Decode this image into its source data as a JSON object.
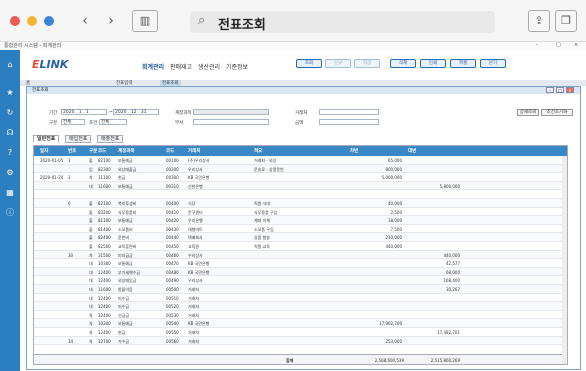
{
  "mac": {
    "title": "전표조회"
  },
  "win": {
    "doc_title": "통합관리 시스템 - 회계관리",
    "minimize": "-",
    "restore": "□",
    "close": "×"
  },
  "header": {
    "logo_e": "E",
    "logo_link": "LINK",
    "menu": [
      "회계관리",
      "판매재고",
      "생산관리",
      "기준정보"
    ],
    "buttons": [
      "조회",
      "신규",
      "저장",
      "삭제",
      "인쇄",
      "엑셀",
      "닫기"
    ]
  },
  "tabs1": [
    "홈",
    "전표입력",
    "전표조회"
  ],
  "form": {
    "title": "전표조회",
    "period_label": "기간",
    "date_from": "2020 . 1 . 1",
    "date_to": "2020 . 12 . 31",
    "type_label": "구분",
    "type_value": "전체",
    "cond_label": "조건",
    "cond_value": "전체",
    "account_label": "계정과목",
    "dept_label": "부서",
    "client_label": "거래처",
    "amount_label": "금액",
    "btn_detail": "상세조회",
    "btn_reset": "조건초기화"
  },
  "subtabs": [
    "일반전표",
    "매입전표",
    "매출전표"
  ],
  "grid": {
    "columns": [
      "일자",
      "번호",
      "구분",
      "코드",
      "계정과목",
      "코드",
      "거래처",
      "적요",
      "차변",
      "대변"
    ],
    "rows": [
      [
        "2020-01-05",
        "1",
        "출",
        "82100",
        "보통예금",
        "00100",
        "(주)우리상사",
        "거래처 - 외상",
        "65,000",
        ""
      ],
      [
        "",
        "",
        "입",
        "82300",
        "외상매출금",
        "00200",
        "우리상사",
        "운송료 - 상품운반",
        "800,000",
        ""
      ],
      [
        "2020-01-20",
        "3",
        "차",
        "11100",
        "현금",
        "00300",
        "KB 국민은행",
        "",
        "5,000,000",
        ""
      ],
      [
        "",
        "",
        "대",
        "11600",
        "보통예금",
        "00310",
        "신한은행",
        "",
        "",
        "5,800,000"
      ],
      [
        "",
        "",
        "",
        "",
        "",
        "",
        "",
        "",
        "",
        ""
      ],
      [
        "",
        "6",
        "출",
        "82100",
        "복리후생비",
        "00400",
        "식당",
        "직원 식대",
        "40,000",
        ""
      ],
      [
        "",
        "",
        "출",
        "83200",
        "사무용품비",
        "00410",
        "문구센터",
        "사무용품 구입",
        "2,500",
        ""
      ],
      [
        "",
        "",
        "출",
        "81100",
        "보통예금",
        "00420",
        "우리은행",
        "계좌 이체",
        "18,000",
        ""
      ],
      [
        "",
        "",
        "출",
        "81400",
        "소모품비",
        "00430",
        "대형마트",
        "소모품 구입",
        "7,500",
        ""
      ],
      [
        "",
        "",
        "출",
        "82400",
        "운반비",
        "00440",
        "택배회사",
        "상품 발송",
        "210,000",
        ""
      ],
      [
        "",
        "",
        "출",
        "82500",
        "교육훈련비",
        "00450",
        "교육원",
        "직원 교육",
        "440,000",
        ""
      ],
      [
        "",
        "30",
        "차",
        "31500",
        "미지급금",
        "00460",
        "우리상사",
        "",
        "",
        "440,000"
      ],
      [
        "",
        "",
        "대",
        "10300",
        "보통예금",
        "00470",
        "KB 국민은행",
        "",
        "",
        "42,577"
      ],
      [
        "",
        "",
        "대",
        "12400",
        "부가세예수금",
        "00480",
        "KB 국민은행",
        "",
        "",
        "68,000"
      ],
      [
        "",
        "",
        "대",
        "12400",
        "외상매입금",
        "00490",
        "우리상사",
        "",
        "",
        "168,400"
      ],
      [
        "",
        "",
        "대",
        "11600",
        "받을어음",
        "00500",
        "거래처",
        "",
        "",
        "30,267"
      ],
      [
        "",
        "",
        "대",
        "12400",
        "미수금",
        "00510",
        "거래처",
        "",
        "",
        ""
      ],
      [
        "",
        "",
        "대",
        "12400",
        "미수금",
        "00520",
        "거래처",
        "",
        "",
        ""
      ],
      [
        "",
        "",
        "차",
        "12400",
        "선급금",
        "00530",
        "거래처",
        "",
        "",
        ""
      ],
      [
        "",
        "",
        "차",
        "10300",
        "보통예금",
        "00540",
        "KB 국민은행",
        "",
        "17,902,700",
        ""
      ],
      [
        "",
        "",
        "차",
        "12400",
        "현금",
        "00550",
        "거래처",
        "",
        "",
        "17,482,701"
      ],
      [
        "",
        "34",
        "차",
        "32700",
        "가수금",
        "00560",
        "거래처",
        "",
        "253,000",
        ""
      ]
    ],
    "total_label": "합계",
    "total_debit": "2,568,600,539",
    "total_credit": "2,515,860,269"
  }
}
